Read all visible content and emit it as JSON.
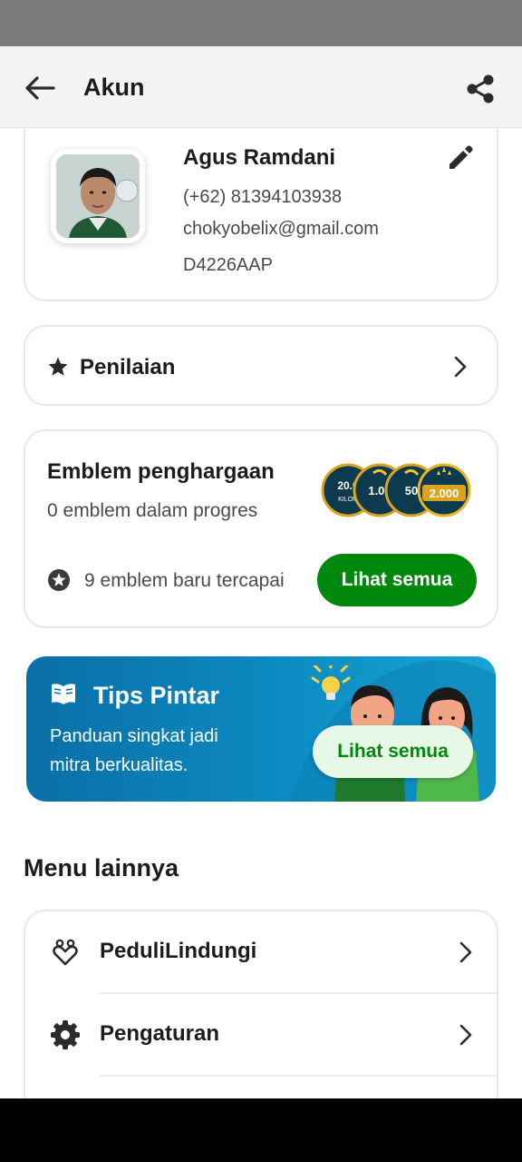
{
  "app_bar": {
    "title": "Akun"
  },
  "profile": {
    "name": "Agus Ramdani",
    "phone": "(+62) 81394103938",
    "email": "chokyobelix@gmail.com",
    "plate": "D4226AAP"
  },
  "rating": {
    "label": "Penilaian"
  },
  "badges": {
    "title": "Emblem penghargaan",
    "progress_text": "0 emblem dalam progres",
    "new_text": "9 emblem baru tercapai",
    "button_label": "Lihat semua",
    "medals": [
      "20.0",
      "1.00",
      "50",
      "2.000"
    ],
    "medal_sub": "KILOM"
  },
  "tips": {
    "title": "Tips Pintar",
    "description": "Panduan singkat jadi mitra berkualitas.",
    "button_label": "Lihat semua"
  },
  "menu": {
    "heading": "Menu lainnya",
    "items": [
      {
        "label": "PeduliLindungi",
        "icon": "heart-hands-icon"
      },
      {
        "label": "Pengaturan",
        "icon": "gear-icon"
      }
    ]
  },
  "colors": {
    "primary_green": "#00880d",
    "tips_blue": "#0c8bc2",
    "light_green": "#e8f8e6"
  }
}
